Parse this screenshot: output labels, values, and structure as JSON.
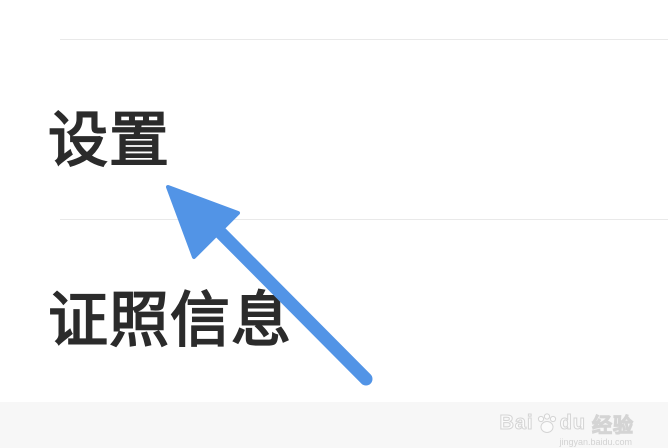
{
  "menu": {
    "items": [
      {
        "label": "设置"
      },
      {
        "label": "证照信息"
      }
    ]
  },
  "annotation": {
    "arrow_color": "#5294e6",
    "points_to": "设置"
  },
  "watermark": {
    "logo_text": "Bai",
    "logo_text_2": "du",
    "brand_cn": "经验",
    "url": "jingyan.baidu.com"
  }
}
